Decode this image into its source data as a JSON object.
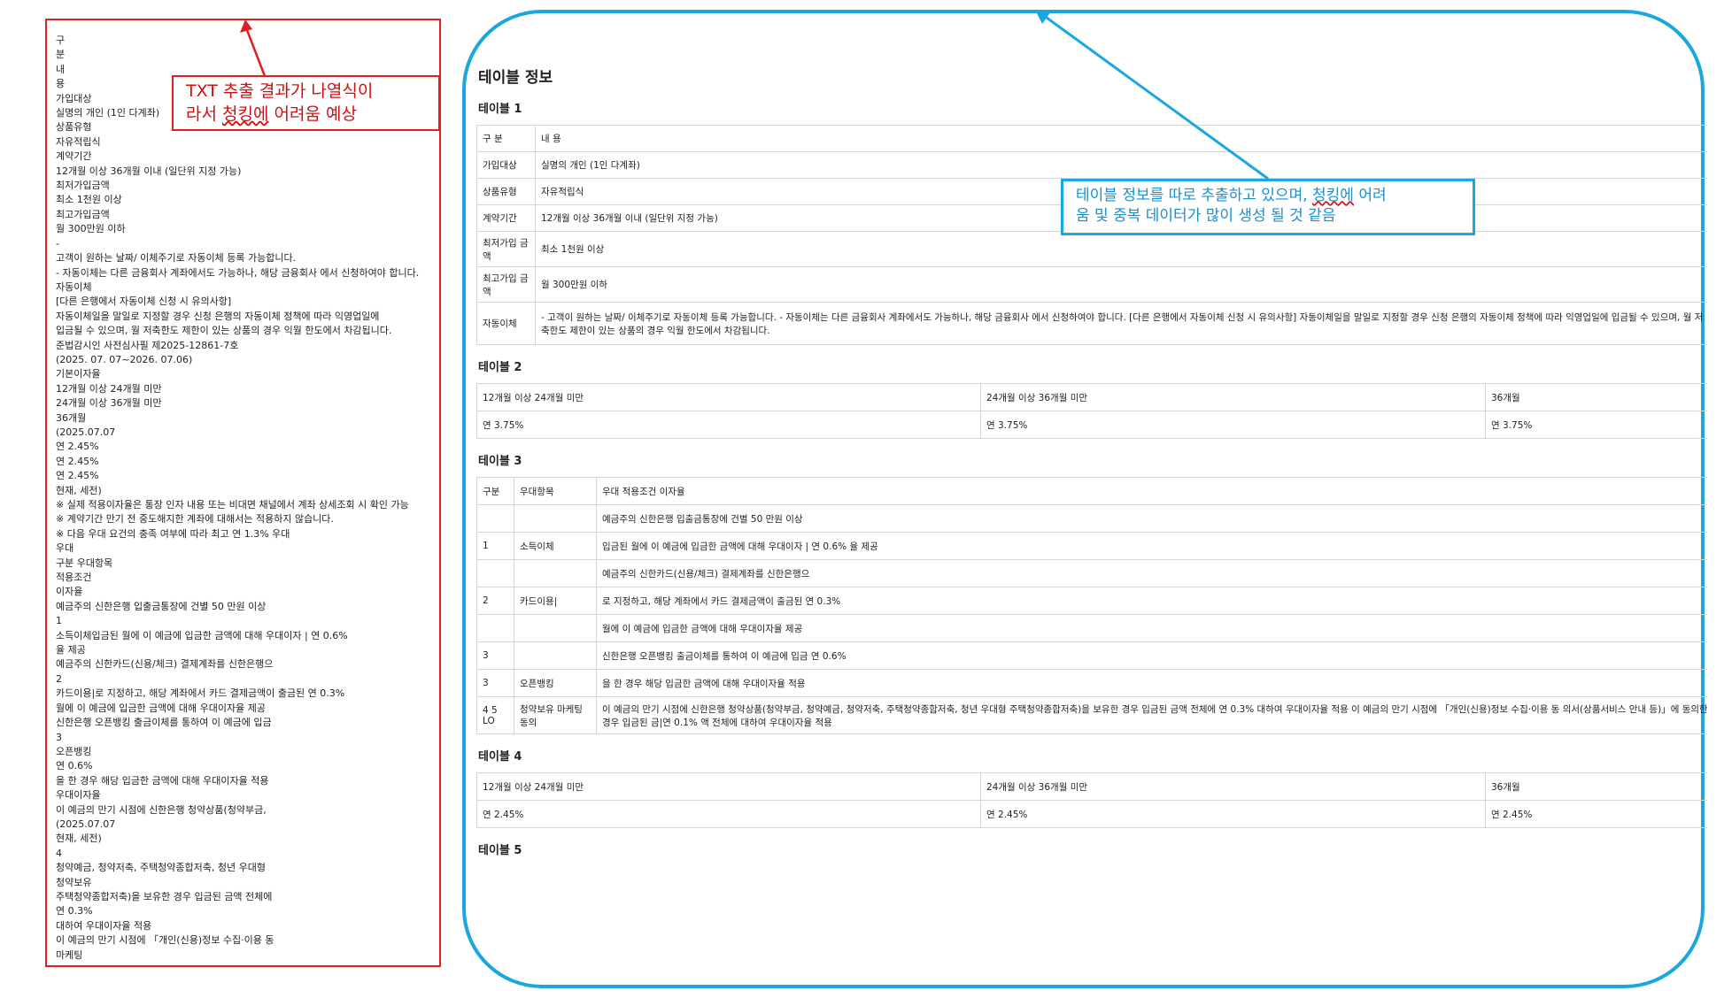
{
  "left_panel": {
    "lines": [
      "구",
      "분",
      "내",
      "용",
      "가입대상",
      "실명의 개인 (1인 다계좌)",
      "상품유형",
      "자유적립식",
      "계약기간",
      "12개월 이상 36개월 이내 (일단위 지정 가능)",
      "최저가입금액",
      "최소 1천원 이상",
      "최고가입금액",
      "월 300만원 이하",
      "-",
      "고객이 원하는 날짜/ 이체주기로 자동이체 등록 가능합니다.",
      "- 자동이체는 다른 금융회사 계좌에서도 가능하나, 해당 금융회사 에서 신청하여야 합니다.",
      "자동이체",
      "[다른 은행에서 자동이체 신청 시 유의사항]",
      "자동이체일을 말일로 지정할 경우 신청 은행의 자동이체 정책에 따라 익영업일에",
      "입금될 수 있으며, 월 저축한도 제한이 있는 상품의 경우 익월 한도에서 차감됩니다.",
      "준법감시인 사전심사필 제2025-12861-7호",
      "(2025. 07. 07~2026. 07.06)",
      "기본이자율",
      "12개월 이상 24개월 미만",
      "24개월 이상 36개월 미만",
      "36개월",
      "(2025.07.07",
      "연 2.45%",
      "연 2.45%",
      "연 2.45%",
      "현재, 세전)",
      "※ 실제 적용이자율은 통장 인자 내용 또는 비대면 채널에서 계좌 상세조회 시 확인 가능",
      "※ 계약기간 만기 전 중도해지한 계좌에 대해서는 적용하지 않습니다.",
      "※ 다음 우대 요건의 충족 여부에 따라 최고 연 1.3% 우대",
      "우대",
      "구분 우대항목",
      "적용조건",
      "이자율",
      "예금주의 신한은행 입출금통장에 건별 50 만원 이상",
      "1",
      "소득이체입금된 월에 이 예금에 입금한 금액에 대해 우대이자 | 연 0.6%",
      "율 제공",
      "예금주의 신한카드(신용/체크) 결제계좌를 신한은행으",
      "2",
      "카드이용|로 지정하고, 해당 계좌에서 카드 결제금액이 출금된 연 0.3%",
      "월에 이 예금에 입금한 금액에 대해 우대이자율 제공",
      "신한은행 오픈뱅킹 출금이체를 통하여 이 예금에 입금",
      "3",
      "오픈뱅킹",
      "연 0.6%",
      "을 한 경우 해당 입금한 금액에 대해 우대이자율 적용",
      "우대이자율",
      "이 예금의 만기 시점에 신한은행 청약상품(청약부금,",
      "(2025.07.07",
      "현재, 세전)",
      "4",
      "청약예금, 청약저축, 주택청약종합저축, 청년 우대형",
      "청약보유",
      "주택청약종합저축)을 보유한 경우 입금된 금액 전체에",
      "연 0.3%",
      "대하여 우대이자율 적용",
      "이 예금의 만기 시점에 「개인(신용)정보 수집·이용 동",
      "마케팅"
    ]
  },
  "callout_left": {
    "line1": "TXT 추출 결과가 나열식이",
    "line2_a": "라서 ",
    "line2_b": "청킹에",
    "line2_c": " 어려움 예상"
  },
  "callout_right": {
    "line1_a": "테이블 정보를 따로 추출하고 있으며, ",
    "line1_b": "청킹에",
    "line1_c": " 어려",
    "line2": "움 및 중복 데이터가 많이 생성 될 것 같음"
  },
  "doc": {
    "title": "테이블 정보",
    "table1": {
      "title": "테이블 1",
      "rows": [
        [
          "구 분",
          "내 용"
        ],
        [
          "가입대상",
          "실명의 개인 (1인 다계좌)"
        ],
        [
          "상품유형",
          "자유적립식"
        ],
        [
          "계약기간",
          "12개월 이상 36개월 이내 (일단위 지정 가능)"
        ],
        [
          "최저가입 금액",
          "최소 1천원 이상"
        ],
        [
          "최고가입 금액",
          "월 300만원 이하"
        ],
        [
          "자동이체",
          "- 고객이 원하는 날짜/ 이체주기로 자동이체 등록 가능합니다. - 자동이체는 다른 금융회사 계좌에서도 가능하나, 해당 금융회사 에서 신청하여야 합니다. [다른 은행에서 자동이체 신청 시 유의사항] 자동이체일을 말일로 지정할 경우 신청 은행의 자동이체 정책에 따라 익영업일에 입금될 수 있으며, 월 저축한도 제한이 있는 상품의 경우 익월 한도에서 차감됩니다."
        ]
      ]
    },
    "table2": {
      "title": "테이블 2",
      "rows": [
        [
          "12개월 이상 24개월 미만",
          "24개월 이상 36개월 미만",
          "36개월"
        ],
        [
          "연 3.75%",
          "연 3.75%",
          "연 3.75%"
        ]
      ]
    },
    "table3": {
      "title": "테이블 3",
      "rows": [
        [
          "구분",
          "우대항목",
          "우대 적용조건 이자율"
        ],
        [
          "",
          "",
          "예금주의 신한은행 입출금통장에 건별 50 만원 이상"
        ],
        [
          "1",
          "소득이체",
          "입금된 월에 이 예금에 입금한 금액에 대해 우대이자 | 연 0.6% 율 제공"
        ],
        [
          "",
          "",
          "예금주의 신한카드(신용/체크) 결제계좌를 신한은행으"
        ],
        [
          "2",
          "카드이용|",
          "로 지정하고, 해당 계좌에서 카드 결제금액이 출금된 연 0.3%"
        ],
        [
          "",
          "",
          "월에 이 예금에 입금한 금액에 대해 우대이자율 제공"
        ],
        [
          "3",
          "",
          "신한은행 오픈뱅킹 출금이체를 통하여 이 예금에 입금 연 0.6%"
        ],
        [
          "3",
          "오픈뱅킹",
          "을 한 경우 해당 입금한 금액에 대해 우대이자율 적용"
        ],
        [
          "4 5 LO",
          "청약보유 마케팅 동의",
          "이 예금의 만기 시점에 신한은행 청약상품(청약부금, 청약예금, 청약저축, 주택청약종합저축, 청년 우대형 주택청약종합저축)을 보유한 경우 입금된 금액 전체에 연 0.3% 대하여 우대이자율 적용 이 예금의 만기 시점에 「개인(신용)정보 수집·이용 동 의서(상품서비스 안내 등)」에 동의한 경우 입금된 금|연 0.1% 액 전체에 대하여 우대이자율 적용"
        ]
      ]
    },
    "table4": {
      "title": "테이블 4",
      "rows": [
        [
          "12개월 이상 24개월 미만",
          "24개월 이상 36개월 미만",
          "36개월"
        ],
        [
          "연 2.45%",
          "연 2.45%",
          "연 2.45%"
        ]
      ]
    },
    "table5": {
      "title": "테이블 5"
    }
  },
  "colors": {
    "red": "#e02020",
    "blue": "#1aa7e0"
  }
}
